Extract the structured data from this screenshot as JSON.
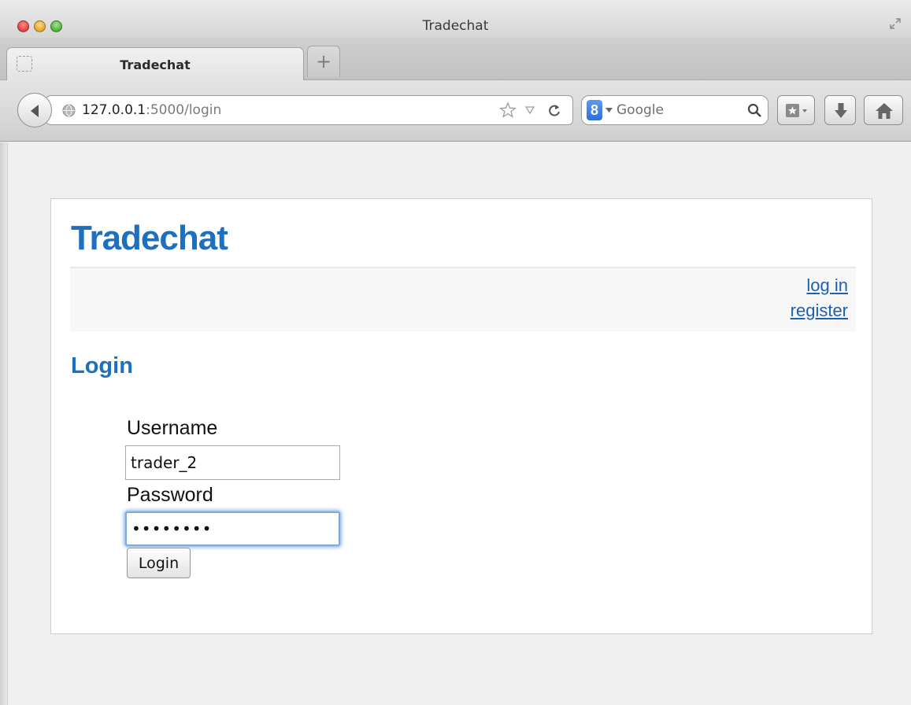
{
  "window": {
    "title": "Tradechat"
  },
  "tab": {
    "title": "Tradechat",
    "new_tab_label": "+"
  },
  "address_bar": {
    "host": "127.0.0.1",
    "rest": ":5000/login"
  },
  "search": {
    "engine_badge": "8",
    "placeholder": "Google"
  },
  "page": {
    "site_title": "Tradechat",
    "nav": {
      "login": "log in",
      "register": "register"
    },
    "section_title": "Login",
    "form": {
      "username_label": "Username",
      "username_value": "trader_2",
      "password_label": "Password",
      "password_value": "••••••••",
      "submit_label": "Login"
    }
  },
  "colors": {
    "link": "#1d5fb4",
    "heading": "#1d6fbf",
    "focus_ring": "#7ea9d9"
  },
  "icons": [
    "fullscreen-icon",
    "back-arrow-icon",
    "globe-icon",
    "star-icon",
    "dropdown-triangle-icon",
    "reload-icon",
    "magnifier-icon",
    "bookmarks-icon",
    "download-icon",
    "home-icon"
  ]
}
